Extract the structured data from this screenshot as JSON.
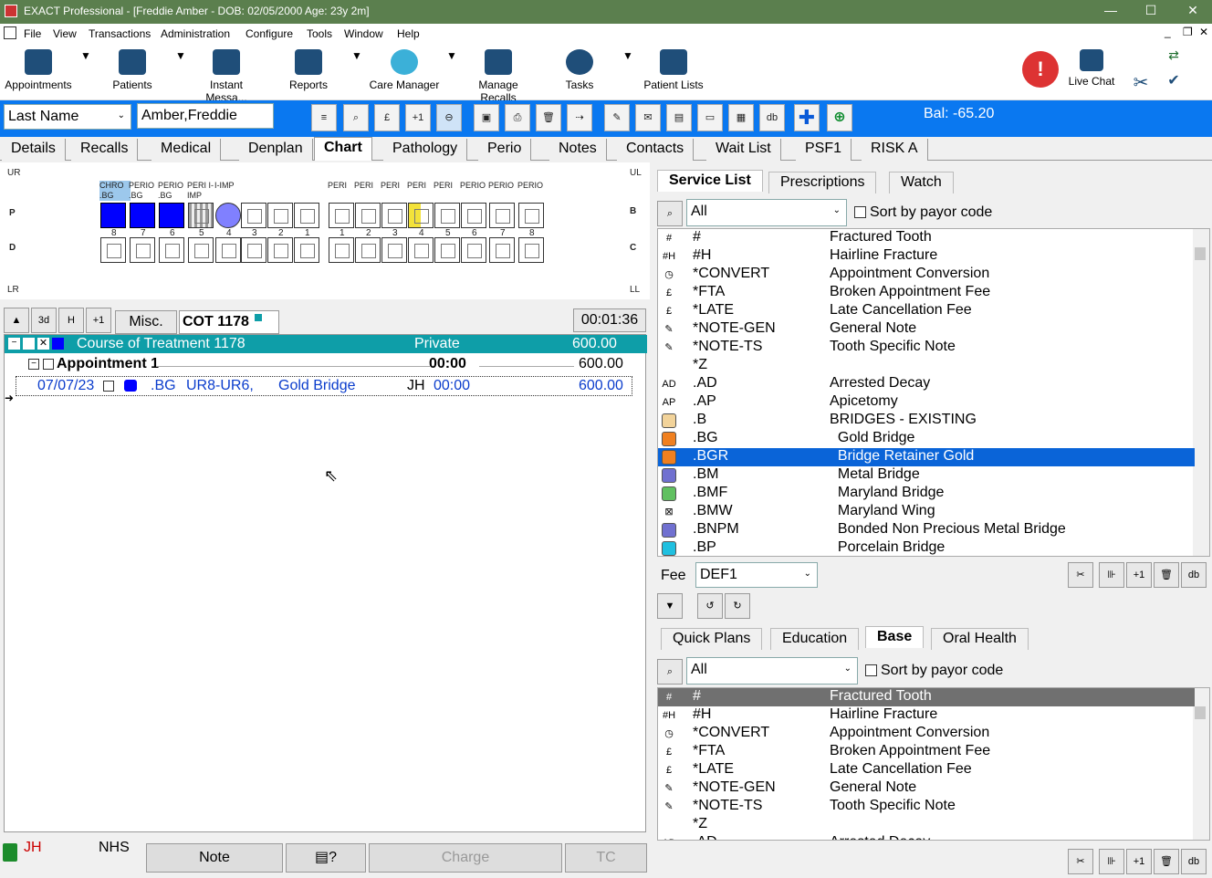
{
  "titlebar": {
    "title": "EXACT Professional - [Freddie Amber - DOB: 02/05/2000 Age: 23y 2m]"
  },
  "menu": [
    "File",
    "View",
    "Transactions",
    "Administration",
    "Configure",
    "Tools",
    "Window",
    "Help"
  ],
  "toolbar": {
    "appointments": "Appointments",
    "patients": "Patients",
    "instant": "Instant Messa...",
    "reports": "Reports",
    "care": "Care Manager",
    "recalls": "Manage Recalls",
    "tasks": "Tasks",
    "plists": "Patient Lists",
    "livechat": "Live Chat"
  },
  "search": {
    "field": "Last Name",
    "value": "Amber,Freddie",
    "btn_plus1": "+1",
    "btn_pound": "£",
    "btn_db": "db"
  },
  "balance": "Bal: -65.20",
  "tabs": [
    "Details",
    "Recalls",
    "Medical",
    "Denplan",
    "Chart",
    "Pathology",
    "Perio",
    "Notes",
    "Contacts",
    "Wait List",
    "PSF1",
    "RISK A"
  ],
  "chart": {
    "ur": "UR",
    "ul": "UL",
    "lr": "LR",
    "ll": "LL",
    "p": "P",
    "d": "D",
    "b": "B",
    "c": "C",
    "upper_labels": [
      "CHRO .BG",
      "PERIO .BG",
      "PERIO .BG",
      "PERI I-IMP",
      "I-IMP",
      "",
      "",
      "",
      "PERI",
      "PERI",
      "PERI",
      "PERI",
      "PERI",
      "PERIO",
      "PERIO",
      "PERIO"
    ],
    "nums": [
      "8",
      "7",
      "6",
      "5",
      "4",
      "3",
      "2",
      "1",
      "1",
      "2",
      "3",
      "4",
      "5",
      "6",
      "7",
      "8"
    ]
  },
  "cot": {
    "btn_3d": "3d",
    "btn_h": "H",
    "btn_plus1": "+1",
    "misc": "Misc.",
    "title": "COT 1178",
    "timer": "00:01:36",
    "row_title": "Course of Treatment 1178",
    "row_type": "Private",
    "row_total": "600.00",
    "appt_label": "Appointment 1",
    "appt_time": "00:00",
    "appt_total": "600.00",
    "item": {
      "date": "07/07/23",
      "code": ".BG",
      "teeth": "UR8-UR6,",
      "desc": "Gold Bridge",
      "clin": "JH",
      "time": "00:00",
      "fee": "600.00"
    }
  },
  "bottom": {
    "clin": "JH",
    "nhs": "NHS",
    "note": "Note",
    "help": "?",
    "charge": "Charge",
    "tc": "TC"
  },
  "right": {
    "tabs1": [
      "Service List",
      "Prescriptions",
      "Watch"
    ],
    "filter": "All",
    "sort": "Sort by payor code",
    "fee_label": "Fee",
    "fee_value": "DEF1",
    "tabs2": [
      "Quick Plans",
      "Education",
      "Base",
      "Oral Health"
    ],
    "services": [
      {
        "icon": "#",
        "code": "#",
        "desc": "Fractured Tooth",
        "color": ""
      },
      {
        "icon": "#H",
        "code": "#H",
        "desc": "Hairline Fracture",
        "color": ""
      },
      {
        "icon": "◷",
        "code": "*CONVERT",
        "desc": "Appointment Conversion",
        "color": ""
      },
      {
        "icon": "£",
        "code": "*FTA",
        "desc": "Broken Appointment Fee",
        "color": ""
      },
      {
        "icon": "£",
        "code": "*LATE",
        "desc": "Late Cancellation Fee",
        "color": ""
      },
      {
        "icon": "✎",
        "code": "*NOTE-GEN",
        "desc": "General Note",
        "color": ""
      },
      {
        "icon": "✎",
        "code": "*NOTE-TS",
        "desc": "Tooth Specific Note",
        "color": ""
      },
      {
        "icon": "",
        "code": "*Z",
        "desc": "",
        "color": ""
      },
      {
        "icon": "AD",
        "code": ".AD",
        "desc": "Arrested Decay",
        "color": ""
      },
      {
        "icon": "AP",
        "code": ".AP",
        "desc": "Apicetomy",
        "color": ""
      },
      {
        "icon": "",
        "code": ".B",
        "desc": "BRIDGES - EXISTING",
        "color": "#f2d39a"
      },
      {
        "icon": "",
        "code": ".BG",
        "desc": "  Gold Bridge",
        "color": "#f08020"
      },
      {
        "icon": "",
        "code": ".BGR",
        "desc": "  Bridge Retainer Gold",
        "color": "#f08020"
      },
      {
        "icon": "",
        "code": ".BM",
        "desc": "  Metal Bridge",
        "color": "#7070d0"
      },
      {
        "icon": "",
        "code": ".BMF",
        "desc": "  Maryland Bridge",
        "color": "#60c060"
      },
      {
        "icon": "⊠",
        "code": ".BMW",
        "desc": "  Maryland Wing",
        "color": ""
      },
      {
        "icon": "",
        "code": ".BNPM",
        "desc": "  Bonded Non Precious Metal Bridge",
        "color": "#7070d0"
      },
      {
        "icon": "",
        "code": ".BP",
        "desc": "  Porcelain Bridge",
        "color": "#20c0e0"
      }
    ],
    "base": [
      {
        "icon": "#",
        "code": "#",
        "desc": "Fractured Tooth"
      },
      {
        "icon": "#H",
        "code": "#H",
        "desc": "Hairline Fracture"
      },
      {
        "icon": "◷",
        "code": "*CONVERT",
        "desc": "Appointment Conversion"
      },
      {
        "icon": "£",
        "code": "*FTA",
        "desc": "Broken Appointment Fee"
      },
      {
        "icon": "£",
        "code": "*LATE",
        "desc": "Late Cancellation Fee"
      },
      {
        "icon": "✎",
        "code": "*NOTE-GEN",
        "desc": "General Note"
      },
      {
        "icon": "✎",
        "code": "*NOTE-TS",
        "desc": "Tooth Specific Note"
      },
      {
        "icon": "",
        "code": "*Z",
        "desc": ""
      },
      {
        "icon": "AD",
        "code": ".AD",
        "desc": "Arrested Decay"
      }
    ]
  }
}
